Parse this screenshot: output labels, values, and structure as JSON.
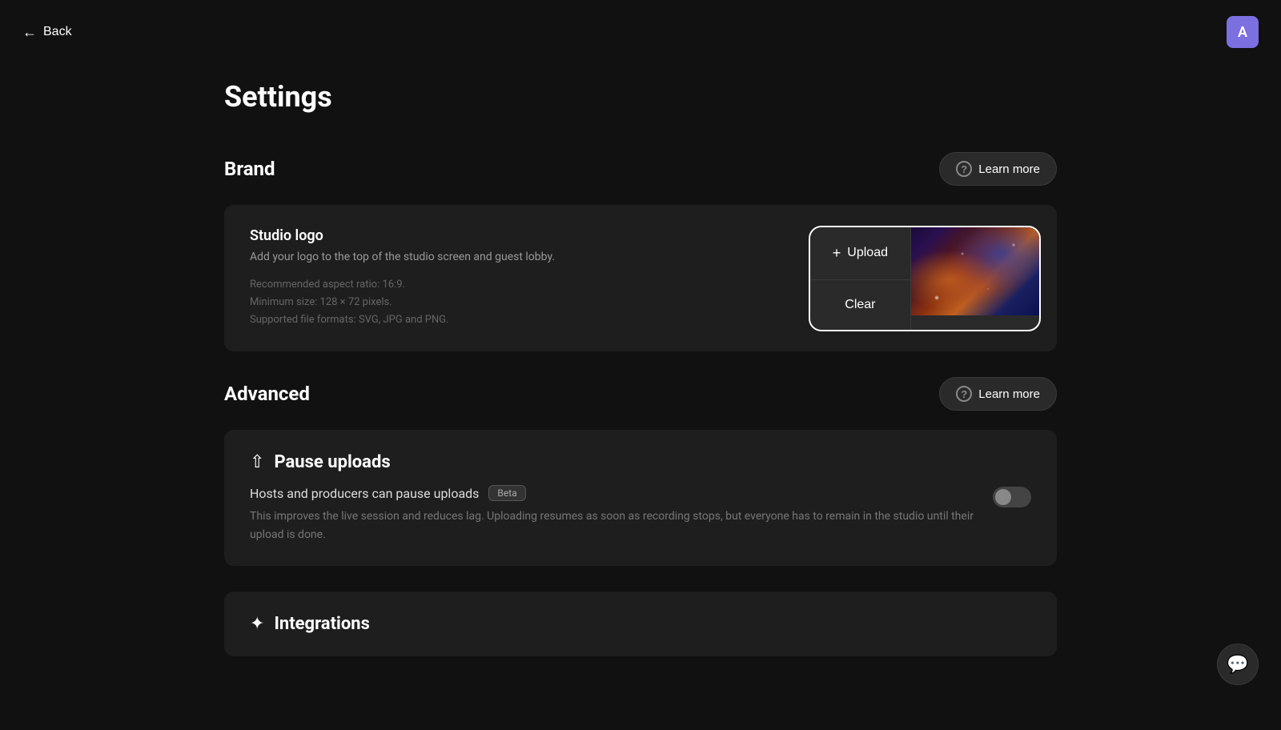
{
  "header": {
    "back_label": "Back",
    "avatar_letter": "A"
  },
  "page": {
    "title": "Settings"
  },
  "brand_section": {
    "title": "Brand",
    "learn_more_label": "Learn more",
    "card": {
      "label": "Studio logo",
      "description": "Add your logo to the top of the studio screen and guest lobby.",
      "meta_line1": "Recommended aspect ratio: 16:9.",
      "meta_line2": "Minimum size: 128 × 72 pixels.",
      "meta_line3": "Supported file formats: SVG, JPG and PNG."
    },
    "upload_label": "Upload",
    "clear_label": "Clear"
  },
  "advanced_section": {
    "title": "Advanced",
    "learn_more_label": "Learn more",
    "pause_uploads": {
      "section_title": "Pause uploads",
      "toggle_label": "Hosts and producers can pause uploads",
      "badge": "Beta",
      "description": "This improves the live session and reduces lag. Uploading resumes as soon as recording stops, but everyone has to remain in the studio until their upload is done."
    }
  },
  "integrations_section": {
    "title": "Integrations"
  },
  "chat_icon": "💬"
}
